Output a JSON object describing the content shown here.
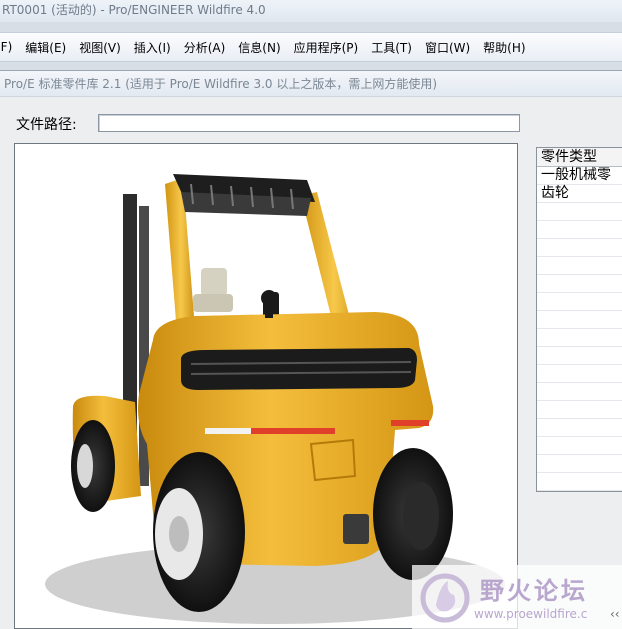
{
  "window": {
    "title": "RT0001 (活动的) - Pro/ENGINEER Wildfire 4.0"
  },
  "menu": {
    "items": [
      {
        "label": "(F)"
      },
      {
        "label": "编辑(E)"
      },
      {
        "label": "视图(V)"
      },
      {
        "label": "插入(I)"
      },
      {
        "label": "分析(A)"
      },
      {
        "label": "信息(N)"
      },
      {
        "label": "应用程序(P)"
      },
      {
        "label": "工具(T)"
      },
      {
        "label": "窗口(W)"
      },
      {
        "label": "帮助(H)"
      }
    ]
  },
  "dialog": {
    "title": "Pro/E 标准零件库 2.1 (适用于 Pro/E Wildfire 3.0 以上之版本，需上网方能使用)",
    "path_label": "文件路径:",
    "path_value": "",
    "preview": {
      "subject": "forklift-3d-model"
    },
    "part_list": {
      "header": "零件类型",
      "items": [
        {
          "label": "一般机械零"
        },
        {
          "label": "齿轮"
        }
      ]
    }
  },
  "watermark": {
    "name": "野火论坛",
    "url": "www.proewildfire.c",
    "arrow": "‹‹"
  },
  "colors": {
    "forklift_body": "#e8a91e",
    "forklift_dark": "#2a2a2a",
    "watermark": "#b9a6cf"
  }
}
